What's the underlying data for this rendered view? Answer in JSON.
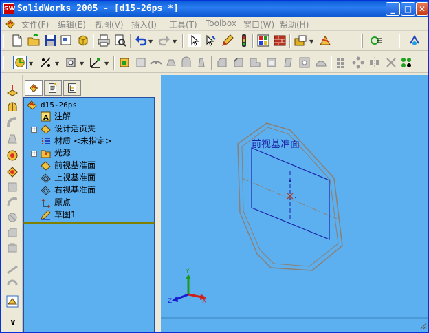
{
  "window": {
    "title": "SolidWorks 2005 - [d15-26ps *]",
    "app_icon": "SW",
    "minimize_glyph": "_",
    "maximize_glyph": "□",
    "close_glyph": "✕"
  },
  "menubar": {
    "items": [
      {
        "label": "文件(F)"
      },
      {
        "label": "编辑(E)"
      },
      {
        "label": "视图(V)"
      },
      {
        "label": "插入(I)"
      },
      {
        "label": "工具(T)"
      },
      {
        "label": "Toolbox"
      },
      {
        "label": "窗口(W)"
      },
      {
        "label": "帮助(H)"
      }
    ]
  },
  "colors": {
    "title_bar": "#0a5cd8",
    "viewport_bg": "#5db0f0",
    "tree_bg": "#5db0f0",
    "plane_outline": "#1a23a8",
    "boundary": "#8c7f73",
    "axis_x": "#d0201a",
    "axis_y": "#1a9a1a",
    "axis_z": "#1a1ad0"
  },
  "feature_tree": {
    "tabs": [
      "feature-manager-tab",
      "property-manager-tab",
      "configuration-manager-tab"
    ],
    "root": "d15-26ps",
    "nodes": [
      {
        "label": "注解",
        "icon": "annotations-icon",
        "expandable": false
      },
      {
        "label": "设计活页夹",
        "icon": "design-binder-icon",
        "expandable": true
      },
      {
        "label": "材质 <未指定>",
        "icon": "material-icon",
        "expandable": false
      },
      {
        "label": "光源",
        "icon": "lights-icon",
        "expandable": true
      },
      {
        "label": "前视基准面",
        "icon": "plane-icon",
        "expandable": false
      },
      {
        "label": "上视基准面",
        "icon": "plane-icon",
        "expandable": false
      },
      {
        "label": "右视基准面",
        "icon": "plane-icon",
        "expandable": false
      },
      {
        "label": "原点",
        "icon": "origin-icon",
        "expandable": false
      },
      {
        "label": "草图1",
        "icon": "sketch-icon",
        "expandable": false
      }
    ]
  },
  "viewport": {
    "plane_label": "前视基准面",
    "triad": {
      "x": "X",
      "y": "Y",
      "z": "Z"
    }
  },
  "scroll_glyph": "»"
}
